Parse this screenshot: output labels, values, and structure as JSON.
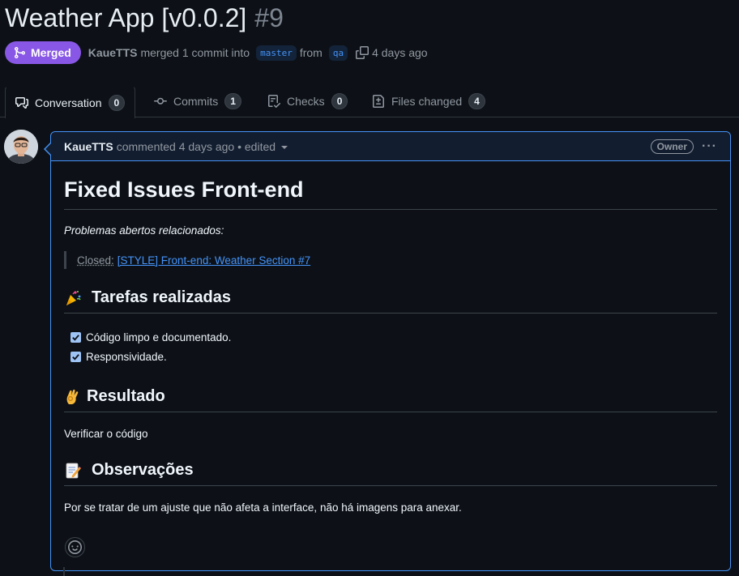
{
  "pr": {
    "title": "Weather App [v0.0.2]",
    "number": "#9",
    "state": "Merged",
    "author": "KaueTTS",
    "merged_text": "merged 1 commit into",
    "base_branch": "master",
    "from_text": "from",
    "head_branch": "qa",
    "time": "4 days ago"
  },
  "tabs": [
    {
      "label": "Conversation",
      "count": "0",
      "icon": "comment-discussion-icon",
      "active": true
    },
    {
      "label": "Commits",
      "count": "1",
      "icon": "git-commit-icon"
    },
    {
      "label": "Checks",
      "count": "0",
      "icon": "checklist-icon"
    },
    {
      "label": "Files changed",
      "count": "4",
      "icon": "file-diff-icon"
    }
  ],
  "comment": {
    "author": "KaueTTS",
    "meta": "commented 4 days ago • edited",
    "badge": "Owner",
    "more": "···",
    "heading": "Fixed Issues Front-end",
    "related_label": "Problemas abertos relacionados:",
    "closed_label": "Closed:",
    "closed_link": "[STYLE] Front-end: Weather Section #7",
    "sections": {
      "tasks_title": "Tarefas realizadas",
      "tasks": [
        "Código limpo e documentado.",
        "Responsividade."
      ],
      "result_title": "Resultado",
      "result_text": "Verificar o código",
      "notes_title": "Observações",
      "notes_text": "Por se tratar de um ajuste que não afeta a interface, não há imagens para anexar."
    }
  },
  "colors": {
    "merged": "#8957e5",
    "accent": "#4493f8",
    "background": "#0d1117"
  }
}
